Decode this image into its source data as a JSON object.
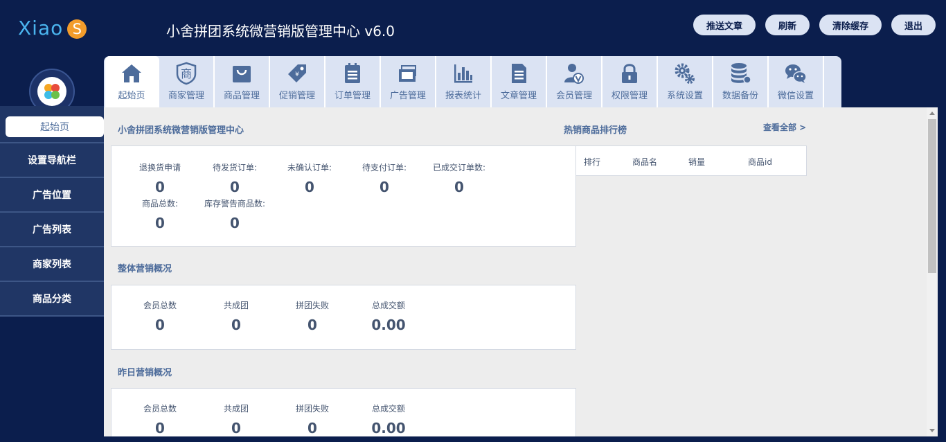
{
  "header": {
    "logo_text": "Xiao",
    "logo_badge": "S",
    "title": "小舍拼团系统微营销版管理中心 v6.0",
    "buttons": [
      "推送文章",
      "刷新",
      "清除缓存",
      "退出"
    ]
  },
  "tabs": [
    {
      "label": "起始页",
      "icon": "home-icon"
    },
    {
      "label": "商家管理",
      "icon": "merchant-icon"
    },
    {
      "label": "商品管理",
      "icon": "shopping-bag-icon"
    },
    {
      "label": "促销管理",
      "icon": "price-tag-icon"
    },
    {
      "label": "订单管理",
      "icon": "clipboard-icon"
    },
    {
      "label": "广告管理",
      "icon": "ad-cards-icon"
    },
    {
      "label": "报表统计",
      "icon": "bar-chart-icon"
    },
    {
      "label": "文章管理",
      "icon": "document-icon"
    },
    {
      "label": "会员管理",
      "icon": "member-icon"
    },
    {
      "label": "权限管理",
      "icon": "lock-icon"
    },
    {
      "label": "系统设置",
      "icon": "gears-icon"
    },
    {
      "label": "数据备份",
      "icon": "database-icon"
    },
    {
      "label": "微信设置",
      "icon": "wechat-icon"
    }
  ],
  "sidebar": {
    "items": [
      "起始页",
      "设置导航栏",
      "广告位置",
      "广告列表",
      "商家列表",
      "商品分类"
    ]
  },
  "main": {
    "center_title": "小舍拼团系统微营销版管理中心",
    "orders": [
      {
        "label": "退换货申请",
        "value": "0"
      },
      {
        "label": "待发货订单:",
        "value": "0"
      },
      {
        "label": "未确认订单:",
        "value": "0"
      },
      {
        "label": "待支付订单:",
        "value": "0"
      },
      {
        "label": "已成交订单数:",
        "value": "0"
      },
      {
        "label": "商品总数:",
        "value": "0"
      },
      {
        "label": "库存警告商品数:",
        "value": "0"
      }
    ],
    "overall_title": "整体营销概况",
    "overall": [
      {
        "label": "会员总数",
        "value": "0"
      },
      {
        "label": "共成团",
        "value": "0"
      },
      {
        "label": "拼团失败",
        "value": "0"
      },
      {
        "label": "总成交额",
        "value": "0.00"
      }
    ],
    "yesterday_title": "昨日营销概况",
    "yesterday": [
      {
        "label": "会员总数",
        "value": "0"
      },
      {
        "label": "共成团",
        "value": "0"
      },
      {
        "label": "拼团失败",
        "value": "0"
      },
      {
        "label": "总成交额",
        "value": "0.00"
      }
    ],
    "ranking": {
      "title": "热销商品排行榜",
      "view_all": "查看全部 >",
      "columns": [
        "排行",
        "商品名",
        "销量",
        "商品id"
      ]
    }
  },
  "colors": {
    "background": "#0b1e4d",
    "accent": "#4d6c9b",
    "logo": "#4ab4ee",
    "logo_badge": "#f39c2b"
  }
}
